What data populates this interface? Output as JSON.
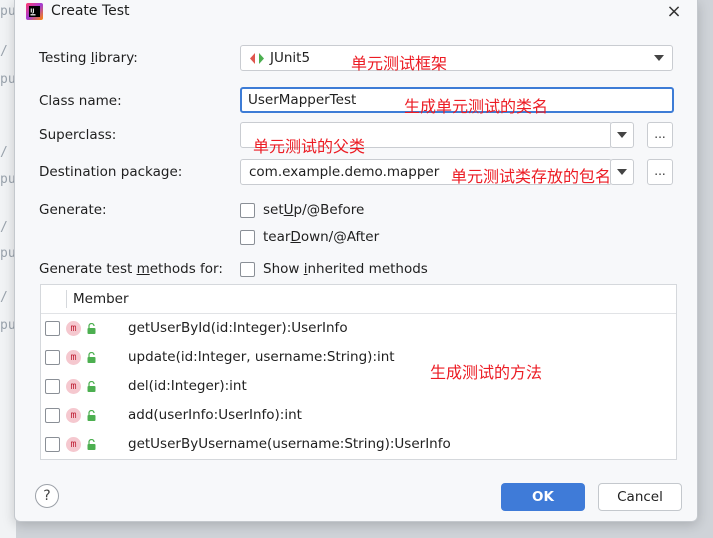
{
  "dialog": {
    "title": "Create Test",
    "close_glyph": "×"
  },
  "form": {
    "testing_library": {
      "label_pre": "Testing ",
      "label_u": "l",
      "label_post": "ibrary:",
      "value": "JUnit5"
    },
    "class_name": {
      "label": "Class name:",
      "value": "UserMapperTest"
    },
    "superclass": {
      "label": "Superclass:",
      "value": ""
    },
    "destination_package": {
      "label": "Destination package:",
      "value": "com.example.demo.mapper"
    },
    "dots_label": "...",
    "generate": {
      "label": "Generate:",
      "setup": {
        "pre": "set",
        "u": "U",
        "post": "p/@Before",
        "checked": false
      },
      "teardown": {
        "pre": "tear",
        "u": "D",
        "post": "own/@After",
        "checked": false
      }
    },
    "generate_methods": {
      "label_pre": "Generate test ",
      "label_u": "m",
      "label_post": "ethods for:",
      "show_inherited": {
        "pre": "Show ",
        "u": "i",
        "post": "nherited methods",
        "checked": false
      }
    }
  },
  "annotations": {
    "library": "单元测试框架",
    "class_name": "生成单元测试的类名",
    "superclass": "单元测试的父类",
    "package": "单元测试类存放的包名",
    "methods": "生成测试的方法"
  },
  "table": {
    "header": "Member",
    "method_icon": "m",
    "rows": [
      {
        "signature": "getUserById(id:Integer):UserInfo"
      },
      {
        "signature": "update(id:Integer, username:String):int"
      },
      {
        "signature": "del(id:Integer):int"
      },
      {
        "signature": "add(userInfo:UserInfo):int"
      },
      {
        "signature": "getUserByUsername(username:String):UserInfo"
      }
    ]
  },
  "footer": {
    "help": "?",
    "ok": "OK",
    "cancel": "Cancel"
  },
  "background": {
    "code_glyphs": [
      "pu",
      "/",
      "pu",
      "/",
      "pu",
      "/",
      "pu",
      "/",
      "pu"
    ]
  },
  "colors": {
    "accent": "#3f7bd8",
    "annotation": "#ec1c24",
    "junit_icon": "#4caf50"
  },
  "icons": {
    "app": "intellij-idea-icon",
    "library": "junit-icon",
    "method": "method-icon",
    "visibility": "public-lock-icon"
  }
}
